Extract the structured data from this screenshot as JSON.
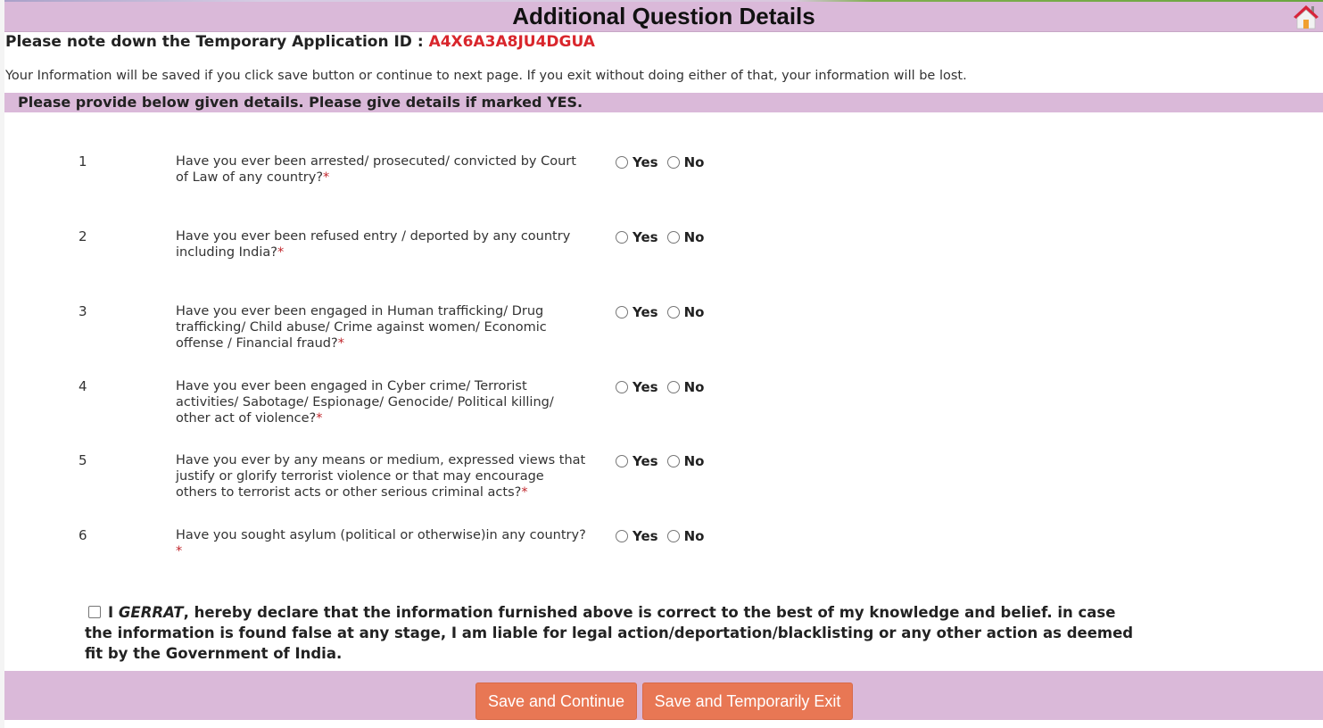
{
  "header": {
    "title": "Additional Question Details",
    "home_icon": "home-icon"
  },
  "application": {
    "id_label": "Please note down the Temporary Application ID : ",
    "id_value": "A4X6A3A8JU4DGUA"
  },
  "save_note": "Your Information will be saved if you click save button or continue to next page. If you exit without doing either of that, your information will be lost.",
  "section_title": "Please provide below given details. Please give details if marked YES.",
  "required_marker": "*",
  "options": {
    "yes": "Yes",
    "no": "No"
  },
  "questions": [
    {
      "num": "1",
      "text": "Have you ever been arrested/ prosecuted/ convicted by Court of Law of any country?",
      "selected": null
    },
    {
      "num": "2",
      "text": "Have you ever been refused entry / deported by any country including India?",
      "selected": null
    },
    {
      "num": "3",
      "text": "Have you ever been engaged in Human trafficking/ Drug trafficking/ Child abuse/ Crime against women/ Economic offense / Financial fraud?",
      "selected": null
    },
    {
      "num": "4",
      "text": "Have you ever been engaged in Cyber crime/ Terrorist activities/ Sabotage/ Espionage/ Genocide/ Political killing/ other act of violence?",
      "selected": null
    },
    {
      "num": "5",
      "text": "Have you ever by any means or medium, expressed views that justify or glorify terrorist violence or that may encourage others to terrorist acts or other serious criminal acts?",
      "selected": null
    },
    {
      "num": "6",
      "text": "Have you sought asylum (political or otherwise)in any country?",
      "selected": null
    }
  ],
  "declaration": {
    "checked": false,
    "prefix": "I ",
    "name": "GERRAT",
    "text": ", hereby declare that the information furnished above is correct to the best of my knowledge and belief. in case the information is found false at any stage, I am liable for legal action/deportation/blacklisting or any other action as deemed fit by the Government of India."
  },
  "buttons": {
    "save_continue": "Save and Continue",
    "save_exit": "Save and Temporarily Exit"
  },
  "colors": {
    "band": "#dab9d9",
    "button": "#e87754",
    "id_value": "#d9262c"
  }
}
